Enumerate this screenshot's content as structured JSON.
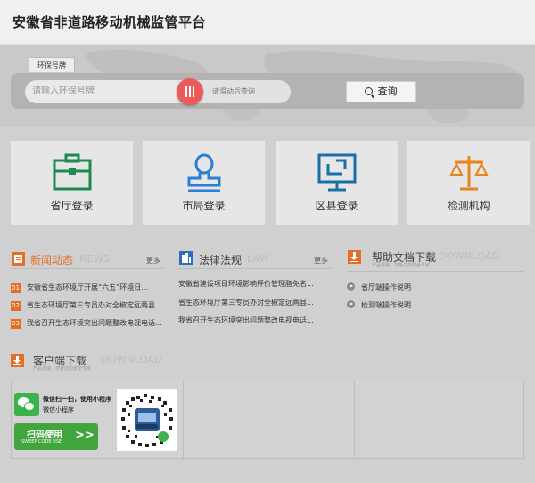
{
  "header": {
    "title": "安徽省非道路移动机械监管平台"
  },
  "search": {
    "tab_label": "环保号牌",
    "plate_placeholder": "请输入环保号牌",
    "slider_hint": "请滑动后查询",
    "search_button": "查询"
  },
  "logins": [
    {
      "label": "省厅登录",
      "icon": "briefcase-icon",
      "color": "#1e8a4f"
    },
    {
      "label": "市局登录",
      "icon": "stamp-icon",
      "color": "#2a7fd4"
    },
    {
      "label": "区县登录",
      "icon": "monitor-icon",
      "color": "#1a6fa8"
    },
    {
      "label": "检测机构",
      "icon": "scale-icon",
      "color": "#e6841d"
    }
  ],
  "news": {
    "title": "新闻动态",
    "en": "NEWS",
    "more": "更多",
    "items": [
      {
        "num": "01",
        "text": "安徽省生态环境厅开展“六五”环境日..."
      },
      {
        "num": "02",
        "text": "省生态环境厅第三专员办对全椒定远两县..."
      },
      {
        "num": "03",
        "text": "我省召开生态环境突出问题整改电视电话..."
      }
    ]
  },
  "law": {
    "title": "法律法规",
    "en": "LAW",
    "more": "更多",
    "items": [
      "安徽省建设项目环境影响评价管理脂免名...",
      "省生态环境厅第三专员办对全椒定远两县...",
      "我省召开生态环境突出问题整改电视电话..."
    ]
  },
  "help": {
    "title": "帮助文档下载",
    "en": "DOWNLOAD",
    "sub": "产品测速，您身边的安全专家",
    "items": [
      "省厅端操作说明",
      "检测端操作说明"
    ]
  },
  "client": {
    "title": "客户端下载",
    "en": "DOWNLOAD",
    "sub": "产品测速，您身边的安全专家",
    "wechat_line1": "微信扫一扫，使用小程序",
    "wechat_line2": "微信小程序",
    "scan_label": "扫码使用",
    "scan_sub": "SWEEP CODE USE",
    "scan_arrow": ">>"
  },
  "colors": {
    "accent_orange": "#e36e25",
    "law_blue": "#2a6fb8",
    "slider_red": "#ee5a5a",
    "wechat_green": "#3bb34a"
  }
}
